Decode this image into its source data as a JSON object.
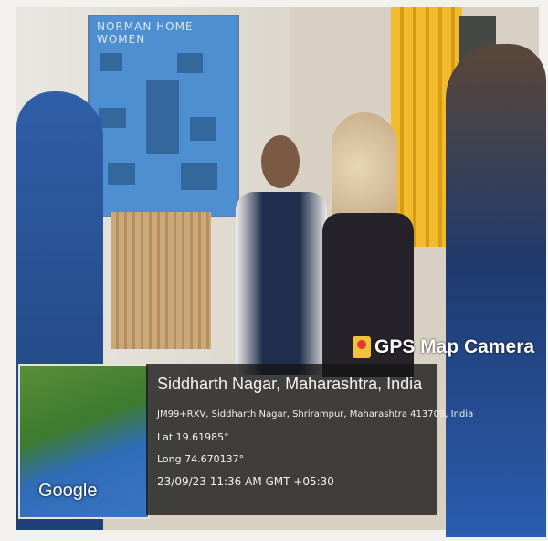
{
  "map": {
    "provider": "Google"
  },
  "badge": {
    "app_name": "GPS Map Camera"
  },
  "location": {
    "title": "Siddharth Nagar, Maharashtra, India",
    "address": "JM99+RXV, Siddharth Nagar, Shrirampur, Maharashtra 413709, India",
    "latitude": "Lat 19.61985°",
    "longitude": "Long 74.670137°",
    "datetime": "23/09/23 11:36 AM GMT +05:30"
  },
  "photo": {
    "board_title": "NORMAN HOME WOMEN"
  },
  "colors": {
    "overlay": "#141414",
    "board": "#4d8fd0",
    "curtain": "#f2bb2c"
  }
}
